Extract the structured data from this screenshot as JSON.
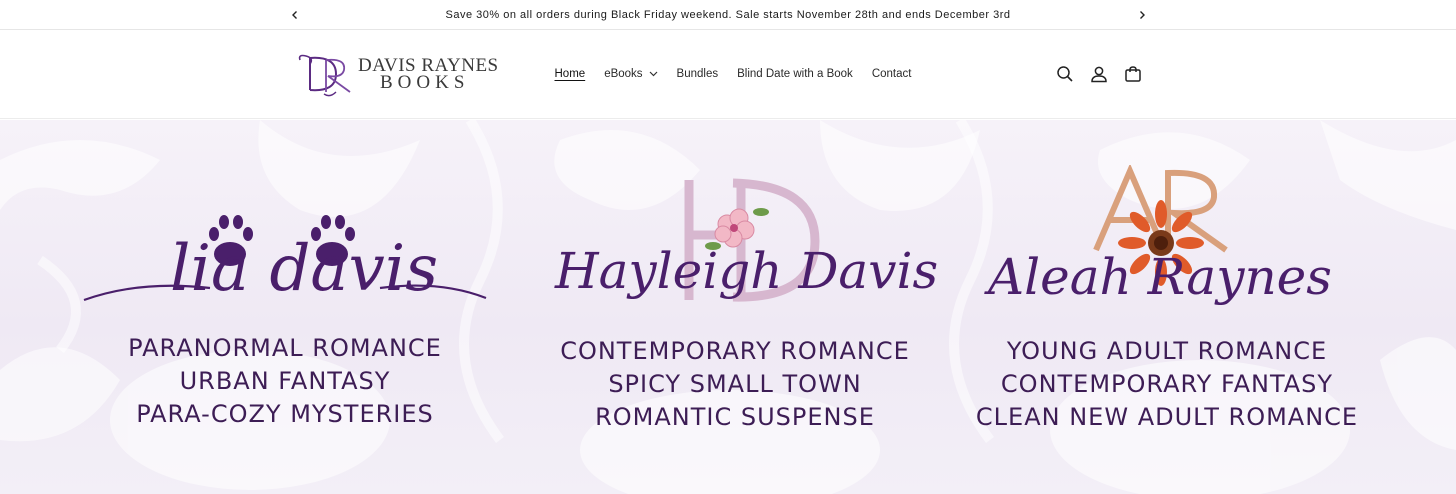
{
  "announcement": {
    "text": "Save 30% on all orders during Black Friday weekend. Sale starts November 28th and ends December 3rd",
    "prev_icon": "chevron-left-icon",
    "next_icon": "chevron-right-icon"
  },
  "header": {
    "logo": {
      "monogram": "DR",
      "name": "DAVIS RAYNES",
      "sub": "BOOKS"
    },
    "nav": [
      {
        "label": "Home",
        "active": true
      },
      {
        "label": "eBooks",
        "has_dropdown": true
      },
      {
        "label": "Bundles"
      },
      {
        "label": "Blind Date with a Book"
      },
      {
        "label": "Contact"
      }
    ],
    "icons": [
      "search-icon",
      "account-icon",
      "cart-icon"
    ]
  },
  "hero": {
    "authors": [
      {
        "script_name": "lia davis",
        "genres": [
          "PARANORMAL ROMANCE",
          "URBAN FANTASY",
          "PARA-COZY MYSTERIES"
        ],
        "emblem": "paw-prints-icon"
      },
      {
        "script_name": "Hayleigh Davis",
        "monogram": "HD",
        "genres": [
          "CONTEMPORARY ROMANCE",
          "SPICY SMALL TOWN",
          "ROMANTIC SUSPENSE"
        ],
        "emblem": "cherry-blossom-icon"
      },
      {
        "script_name": "Aleah Raynes",
        "monogram": "AR",
        "genres": [
          "YOUNG ADULT ROMANCE",
          "CONTEMPORARY FANTASY",
          "CLEAN NEW ADULT ROMANCE"
        ],
        "emblem": "daisy-flower-icon"
      }
    ]
  },
  "colors": {
    "brand_purple": "#4a1f6b",
    "hero_bg": "#f3eff7",
    "rose_gold": "#d9a07c"
  }
}
